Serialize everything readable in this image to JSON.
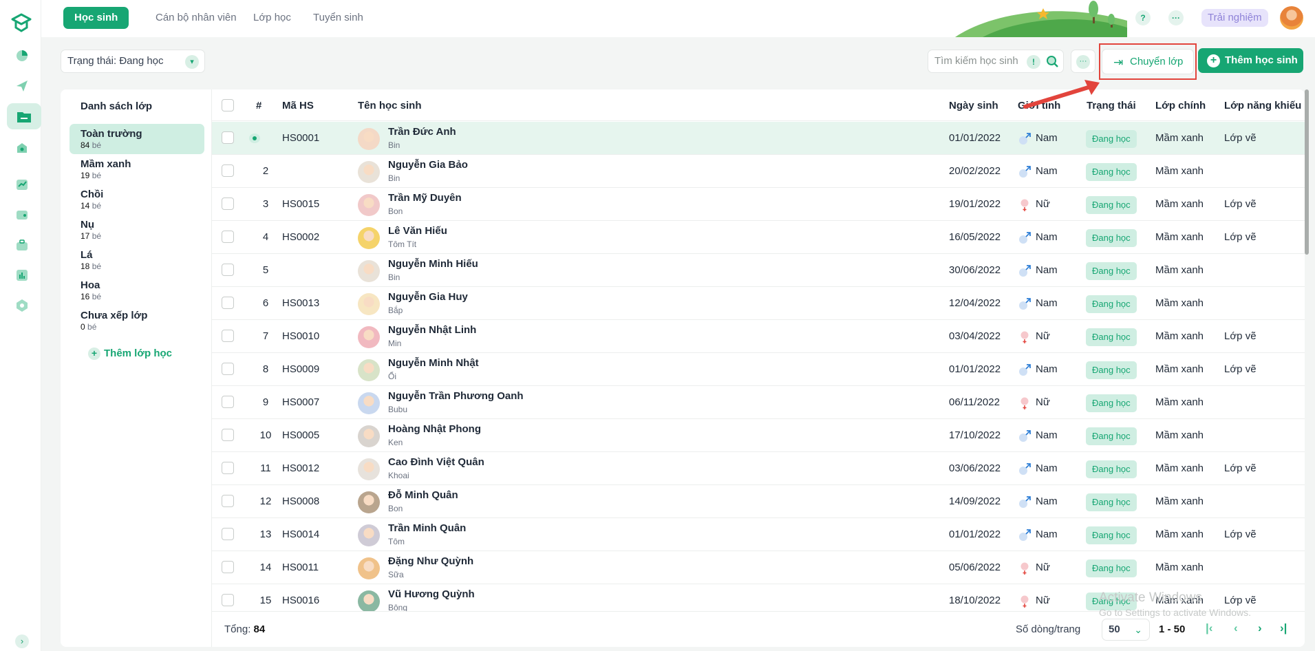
{
  "top_tabs": [
    {
      "label": "Học sinh",
      "active": true
    },
    {
      "label": "Cán bộ nhân viên"
    },
    {
      "label": "Lớp học"
    },
    {
      "label": "Tuyển sinh"
    }
  ],
  "header": {
    "help": "?",
    "more": "···",
    "trial": "Trải nghiệm"
  },
  "filter": {
    "label": "Trạng thái: Đang học"
  },
  "search": {
    "placeholder": "Tìm kiếm học sinh",
    "hint": "!"
  },
  "actions": {
    "more": "···",
    "transfer": "Chuyển lớp",
    "add_student": "Thêm học sinh"
  },
  "sidebar": {
    "title": "Danh sách lớp",
    "unit": "bé",
    "add_class": "Thêm lớp học",
    "classes": [
      {
        "name": "Toàn trường",
        "count": "84"
      },
      {
        "name": "Mầm xanh",
        "count": "19"
      },
      {
        "name": "Chồi",
        "count": "14"
      },
      {
        "name": "Nụ",
        "count": "17"
      },
      {
        "name": "Lá",
        "count": "18"
      },
      {
        "name": "Hoa",
        "count": "16"
      },
      {
        "name": "Chưa xếp lớp",
        "count": "0"
      }
    ]
  },
  "table": {
    "columns": [
      "#",
      "Mã HS",
      "Tên học sinh",
      "Ngày sinh",
      "Giới tính",
      "Trạng thái",
      "Lớp chính",
      "Lớp năng khiếu"
    ],
    "rows": [
      {
        "no": "",
        "code": "HS0001",
        "name": "Trần Đức Anh",
        "nick": "Bin",
        "dob": "01/01/2022",
        "gender": "Nam",
        "status": "Đang học",
        "main": "Mầm xanh",
        "talent": "Lớp vẽ"
      },
      {
        "no": "2",
        "code": "",
        "name": "Nguyễn Gia Bảo",
        "nick": "Bin",
        "dob": "20/02/2022",
        "gender": "Nam",
        "status": "Đang học",
        "main": "Mầm xanh",
        "talent": ""
      },
      {
        "no": "3",
        "code": "HS0015",
        "name": "Trần Mỹ Duyên",
        "nick": "Bon",
        "dob": "19/01/2022",
        "gender": "Nữ",
        "status": "Đang học",
        "main": "Mầm xanh",
        "talent": "Lớp vẽ"
      },
      {
        "no": "4",
        "code": "HS0002",
        "name": "Lê Văn Hiếu",
        "nick": "Tôm Tít",
        "dob": "16/05/2022",
        "gender": "Nam",
        "status": "Đang học",
        "main": "Mầm xanh",
        "talent": "Lớp vẽ"
      },
      {
        "no": "5",
        "code": "",
        "name": "Nguyễn Minh Hiếu",
        "nick": "Bin",
        "dob": "30/06/2022",
        "gender": "Nam",
        "status": "Đang học",
        "main": "Mầm xanh",
        "talent": ""
      },
      {
        "no": "6",
        "code": "HS0013",
        "name": "Nguyễn Gia Huy",
        "nick": "Bắp",
        "dob": "12/04/2022",
        "gender": "Nam",
        "status": "Đang học",
        "main": "Mầm xanh",
        "talent": ""
      },
      {
        "no": "7",
        "code": "HS0010",
        "name": "Nguyễn Nhật Linh",
        "nick": "Min",
        "dob": "03/04/2022",
        "gender": "Nữ",
        "status": "Đang học",
        "main": "Mầm xanh",
        "talent": "Lớp vẽ"
      },
      {
        "no": "8",
        "code": "HS0009",
        "name": "Nguyễn Minh Nhật",
        "nick": "Ổi",
        "dob": "01/01/2022",
        "gender": "Nam",
        "status": "Đang học",
        "main": "Mầm xanh",
        "talent": "Lớp vẽ"
      },
      {
        "no": "9",
        "code": "HS0007",
        "name": "Nguyễn Trần Phương Oanh",
        "nick": "Bubu",
        "dob": "06/11/2022",
        "gender": "Nữ",
        "status": "Đang học",
        "main": "Mầm xanh",
        "talent": ""
      },
      {
        "no": "10",
        "code": "HS0005",
        "name": "Hoàng Nhật Phong",
        "nick": "Ken",
        "dob": "17/10/2022",
        "gender": "Nam",
        "status": "Đang học",
        "main": "Mầm xanh",
        "talent": ""
      },
      {
        "no": "11",
        "code": "HS0012",
        "name": "Cao Đình Việt Quân",
        "nick": "Khoai",
        "dob": "03/06/2022",
        "gender": "Nam",
        "status": "Đang học",
        "main": "Mầm xanh",
        "talent": "Lớp vẽ"
      },
      {
        "no": "12",
        "code": "HS0008",
        "name": "Đỗ Minh Quân",
        "nick": "Bon",
        "dob": "14/09/2022",
        "gender": "Nam",
        "status": "Đang học",
        "main": "Mầm xanh",
        "talent": ""
      },
      {
        "no": "13",
        "code": "HS0014",
        "name": "Trần Minh Quân",
        "nick": "Tôm",
        "dob": "01/01/2022",
        "gender": "Nam",
        "status": "Đang học",
        "main": "Mầm xanh",
        "talent": "Lớp vẽ"
      },
      {
        "no": "14",
        "code": "HS0011",
        "name": "Đặng Như Quỳnh",
        "nick": "Sữa",
        "dob": "05/06/2022",
        "gender": "Nữ",
        "status": "Đang học",
        "main": "Mầm xanh",
        "talent": ""
      },
      {
        "no": "15",
        "code": "HS0016",
        "name": "Vũ Hương Quỳnh",
        "nick": "Bông",
        "dob": "18/10/2022",
        "gender": "Nữ",
        "status": "Đang học",
        "main": "Mầm xanh",
        "talent": "Lớp vẽ"
      }
    ]
  },
  "footer": {
    "total_label": "Tổng:",
    "total": "84",
    "rows_per_page_label": "Số dòng/trang",
    "rows_per_page": "50",
    "range": "1 - 50"
  },
  "watermark": {
    "line1": "Activate Windows",
    "line2": "Go to Settings to activate Windows."
  },
  "colors": {
    "primary": "#17a673",
    "badge_bg": "#cfeee2",
    "highlight": "#e2443c"
  }
}
